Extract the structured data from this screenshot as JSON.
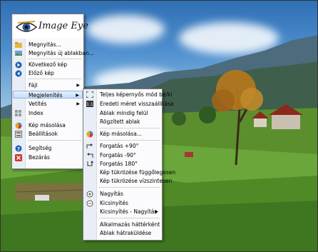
{
  "app": {
    "name": "Image Eye"
  },
  "main_menu": {
    "items": [
      {
        "label": "Megnyitás..."
      },
      {
        "label": "Megnyitás új ablakban..."
      },
      {
        "label": "Következő kép"
      },
      {
        "label": "Előző kép"
      },
      {
        "label": "Fájl"
      },
      {
        "label": "Megjelenítés"
      },
      {
        "label": "Vetítés"
      },
      {
        "label": "Index"
      },
      {
        "label": "Kép másolása"
      },
      {
        "label": "Beállítások"
      },
      {
        "label": "Segítség"
      },
      {
        "label": "Bezárás"
      }
    ]
  },
  "sub_menu": {
    "items": [
      {
        "label": "Teljes képernyős mód be/ki"
      },
      {
        "label": "Eredeti méret visszaállítása"
      },
      {
        "label": "Ablak mindig felül"
      },
      {
        "label": "Rögzített ablak"
      },
      {
        "label": "Kép másolása..."
      },
      {
        "label": "Forgatás +90°"
      },
      {
        "label": "Forgatás -90°"
      },
      {
        "label": "Forgatás 180°"
      },
      {
        "label": "Kép tükrözése függőlegesen"
      },
      {
        "label": "Kép tükrözése vízszintesen"
      },
      {
        "label": "Nagyítás"
      },
      {
        "label": "Kicsinyítés"
      },
      {
        "label": "Kicsinyítés - Nagyítás"
      },
      {
        "label": "Alkalmazás háttérként"
      },
      {
        "label": "Ablak hátraküldése"
      }
    ]
  },
  "colors": {
    "highlight": "#c7ddf6",
    "menu_bg": "#fbfbfd",
    "icon_blue": "#1f5fb5",
    "icon_red": "#d0332b"
  }
}
